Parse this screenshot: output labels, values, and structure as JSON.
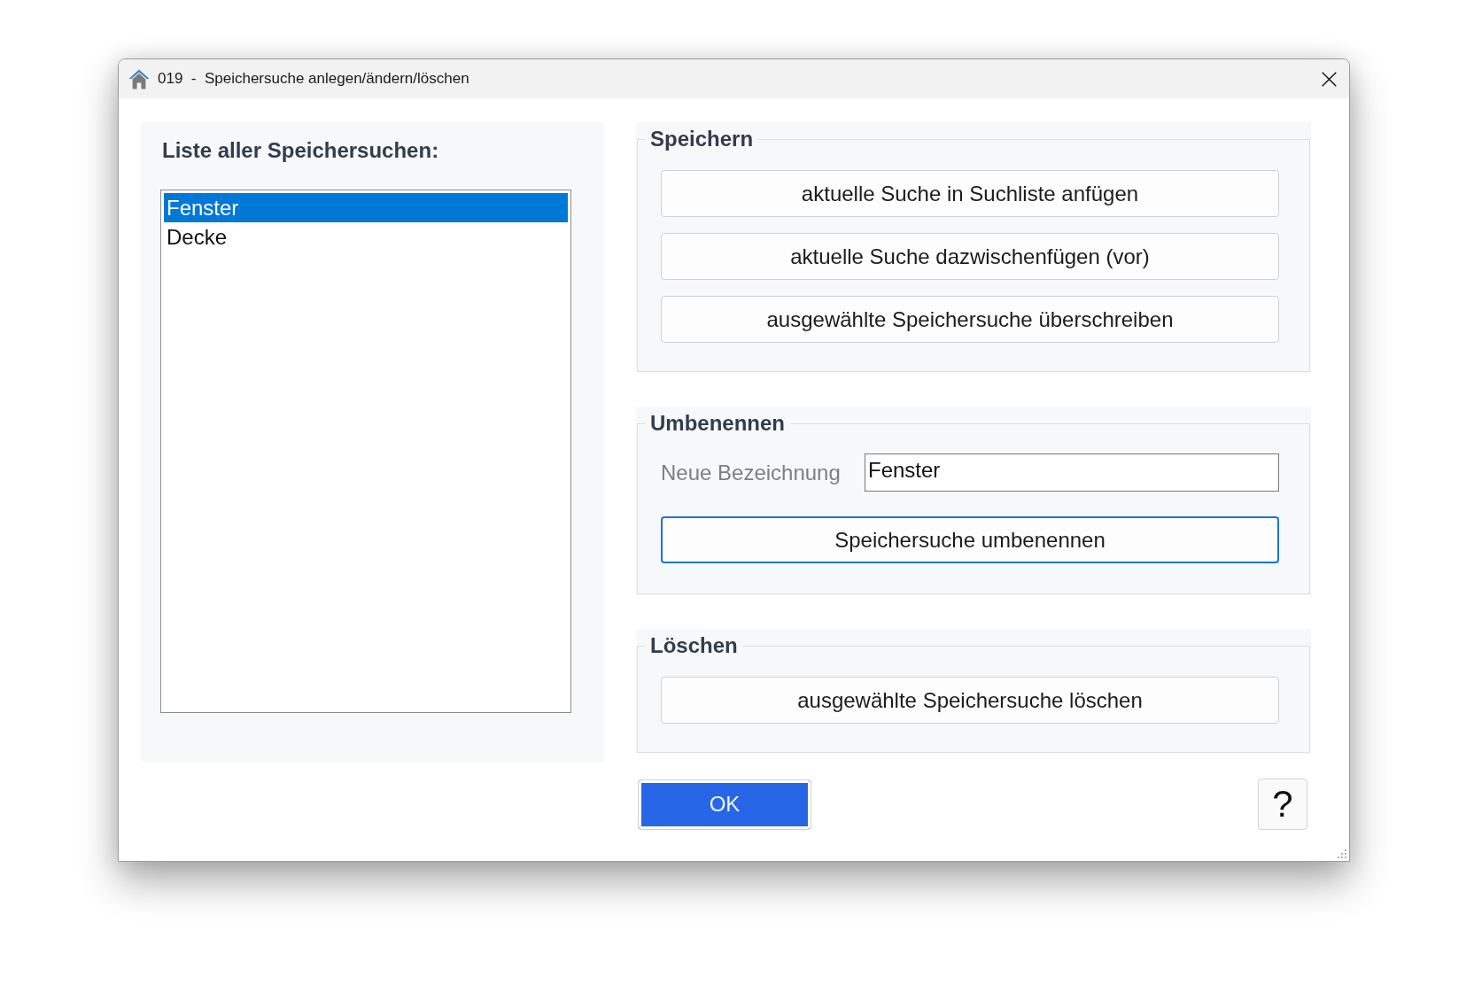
{
  "window": {
    "title": "019  -  Speichersuche anlegen/ändern/löschen"
  },
  "list_panel": {
    "heading": "Liste aller Speichersuchen:",
    "items": [
      {
        "label": "Fenster",
        "selected": true
      },
      {
        "label": "Decke",
        "selected": false
      }
    ]
  },
  "groups": [
    {
      "kind": "buttons",
      "title": "Speichern",
      "buttons": [
        {
          "label": "aktuelle Suche in Suchliste anfügen",
          "focused": false
        },
        {
          "label": "aktuelle Suche dazwischenfügen (vor)",
          "focused": false
        },
        {
          "label": "ausgewählte Speichersuche überschreiben",
          "focused": false
        }
      ]
    },
    {
      "kind": "rename",
      "title": "Umbenennen",
      "field_label": "Neue Bezeichnung",
      "field_value": "Fenster",
      "button": {
        "label": "Speichersuche umbenennen",
        "focused": true
      }
    },
    {
      "kind": "buttons",
      "title": "Löschen",
      "buttons": [
        {
          "label": "ausgewählte Speichersuche löschen",
          "focused": false
        }
      ]
    }
  ],
  "footer": {
    "ok_label": "OK",
    "help_label": "?"
  }
}
